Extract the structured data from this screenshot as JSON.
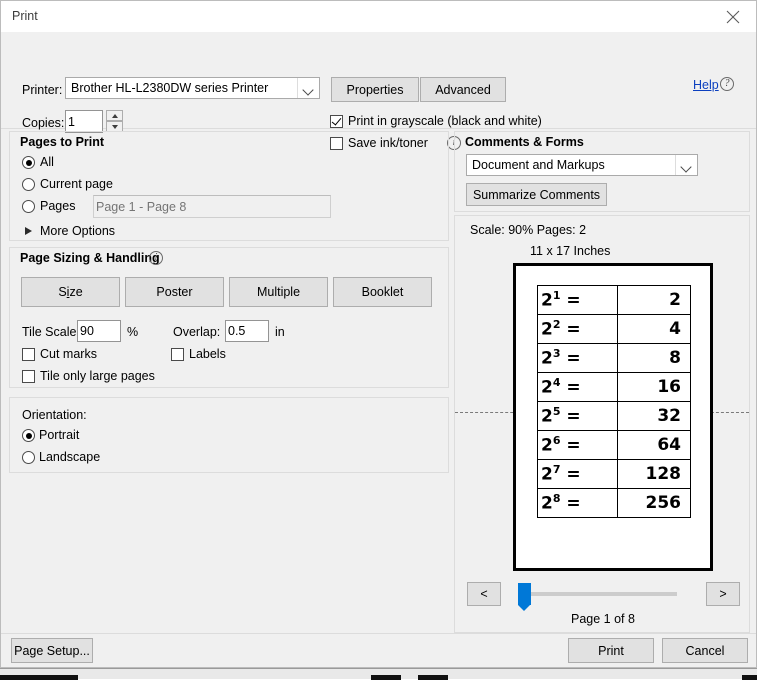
{
  "window": {
    "title": "Print",
    "close_label": "✕"
  },
  "header": {
    "printer_label": "Printer:",
    "printer_value": "Brother HL-L2380DW series Printer",
    "properties_button": "Properties",
    "advanced_button": "Advanced",
    "help_link": "Help",
    "help_icon": "question-circle-icon",
    "copies_label": "Copies:",
    "copies_value": "1",
    "grayscale_label": "Print in grayscale (black and white)",
    "grayscale_checked": true,
    "save_ink_label": "Save ink/toner",
    "save_ink_checked": false,
    "save_ink_info_icon": "info-circle-icon"
  },
  "pages_to_print": {
    "title": "Pages to Print",
    "options": [
      {
        "label": "All",
        "selected": true
      },
      {
        "label": "Current page",
        "selected": false
      },
      {
        "label": "Pages",
        "selected": false
      }
    ],
    "pages_placeholder": "Page 1 - Page 8",
    "more_options_label": "More Options"
  },
  "page_sizing": {
    "title": "Page Sizing & Handling",
    "info_icon": "info-circle-icon",
    "buttons": [
      {
        "label": "Size",
        "accel": "i"
      },
      {
        "label": "Poster",
        "accel": ""
      },
      {
        "label": "Multiple",
        "accel": ""
      },
      {
        "label": "Booklet",
        "accel": ""
      }
    ],
    "tile_scale_label": "Tile Scale:",
    "tile_scale_value": "90",
    "percent_label": "%",
    "overlap_label": "Overlap:",
    "overlap_value": "0.5",
    "inch_label": "in",
    "cut_marks_label": "Cut marks",
    "cut_marks_checked": false,
    "labels_label": "Labels",
    "labels_checked": false,
    "tile_only_large_label": "Tile only large pages",
    "tile_only_large_checked": false
  },
  "orientation": {
    "title": "Orientation:",
    "options": [
      {
        "label": "Portrait",
        "selected": true
      },
      {
        "label": "Landscape",
        "selected": false
      }
    ]
  },
  "comments_forms": {
    "title": "Comments & Forms",
    "selected": "Document and Markups",
    "summarize_button": "Summarize Comments"
  },
  "preview": {
    "scale_line": "Scale:  90% Pages: 2",
    "paper_size_line": "11 x 17 Inches",
    "page_count_label": "Page 1 of 8",
    "prev_button": "<",
    "next_button": ">",
    "document_rows": [
      {
        "expr": "2",
        "exponent": "1",
        "equals": "=",
        "result": "2"
      },
      {
        "expr": "2",
        "exponent": "2",
        "equals": "=",
        "result": "4"
      },
      {
        "expr": "2",
        "exponent": "3",
        "equals": "=",
        "result": "8"
      },
      {
        "expr": "2",
        "exponent": "4",
        "equals": "=",
        "result": "16"
      },
      {
        "expr": "2",
        "exponent": "5",
        "equals": "=",
        "result": "32"
      },
      {
        "expr": "2",
        "exponent": "6",
        "equals": "=",
        "result": "64"
      },
      {
        "expr": "2",
        "exponent": "7",
        "equals": "=",
        "result": "128"
      },
      {
        "expr": "2",
        "exponent": "8",
        "equals": "=",
        "result": "256"
      }
    ]
  },
  "footer": {
    "page_setup_button": "Page Setup...",
    "print_button": "Print",
    "cancel_button": "Cancel"
  },
  "colors": {
    "accent": "#0078d7",
    "link": "#0b3fbf",
    "dialog_bg": "#f0f0f0"
  }
}
